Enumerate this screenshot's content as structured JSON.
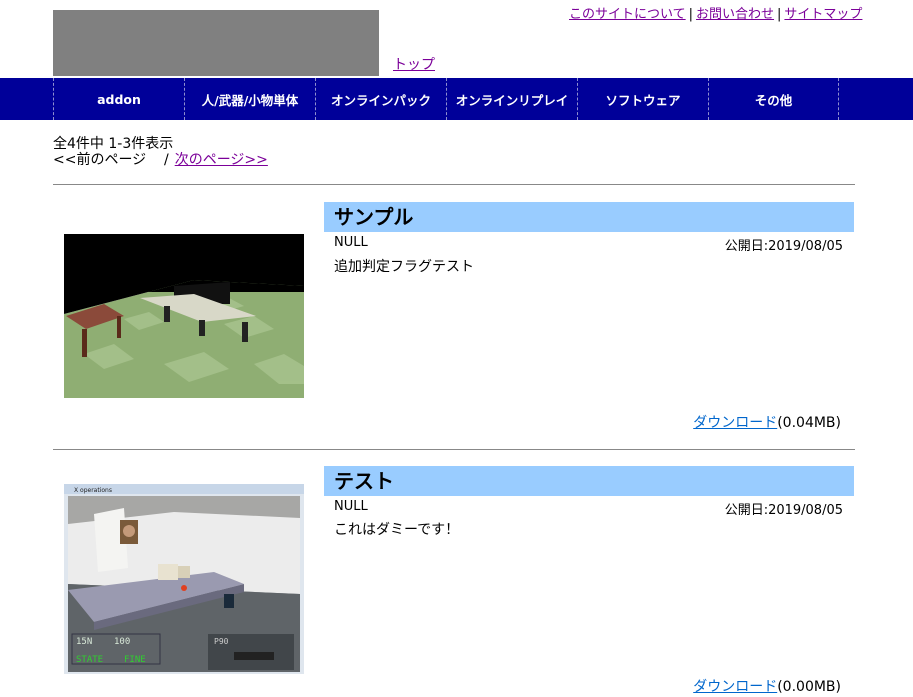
{
  "header": {
    "top_link": "トップ",
    "util_links": [
      "このサイトについて",
      "お問い合わせ",
      "サイトマップ"
    ],
    "separator": "|"
  },
  "nav": [
    "addon",
    "人/武器/小物単体",
    "オンラインパック",
    "オンラインリプレイ",
    "ソフトウェア",
    "その他"
  ],
  "listing": {
    "count_text": "全4件中  1-3件表示",
    "prev_text": "<<前のページ    /",
    "next_text": "次のページ>>"
  },
  "items": [
    {
      "title": "サンプル",
      "author": "NULL",
      "date_label": "公開日:2019/08/05",
      "description": "追加判定フラグテスト",
      "download_label": "ダウンロード",
      "size": "(0.04MB)"
    },
    {
      "title": "テスト",
      "author": "NULL",
      "date_label": "公開日:2019/08/05",
      "description": "これはダミーです！",
      "download_label": "ダウンロード",
      "size": "(0.00MB)",
      "hud": {
        "window_title": "X operations",
        "ammo": "15N",
        "ammo2": "100",
        "state_label": "STATE",
        "state_value": "FINE",
        "weapon": "P90"
      }
    }
  ],
  "colors": {
    "nav_bg": "#000099",
    "title_bg": "#99ccff",
    "visited_link": "#7b0099",
    "download_link": "#0066cc"
  }
}
